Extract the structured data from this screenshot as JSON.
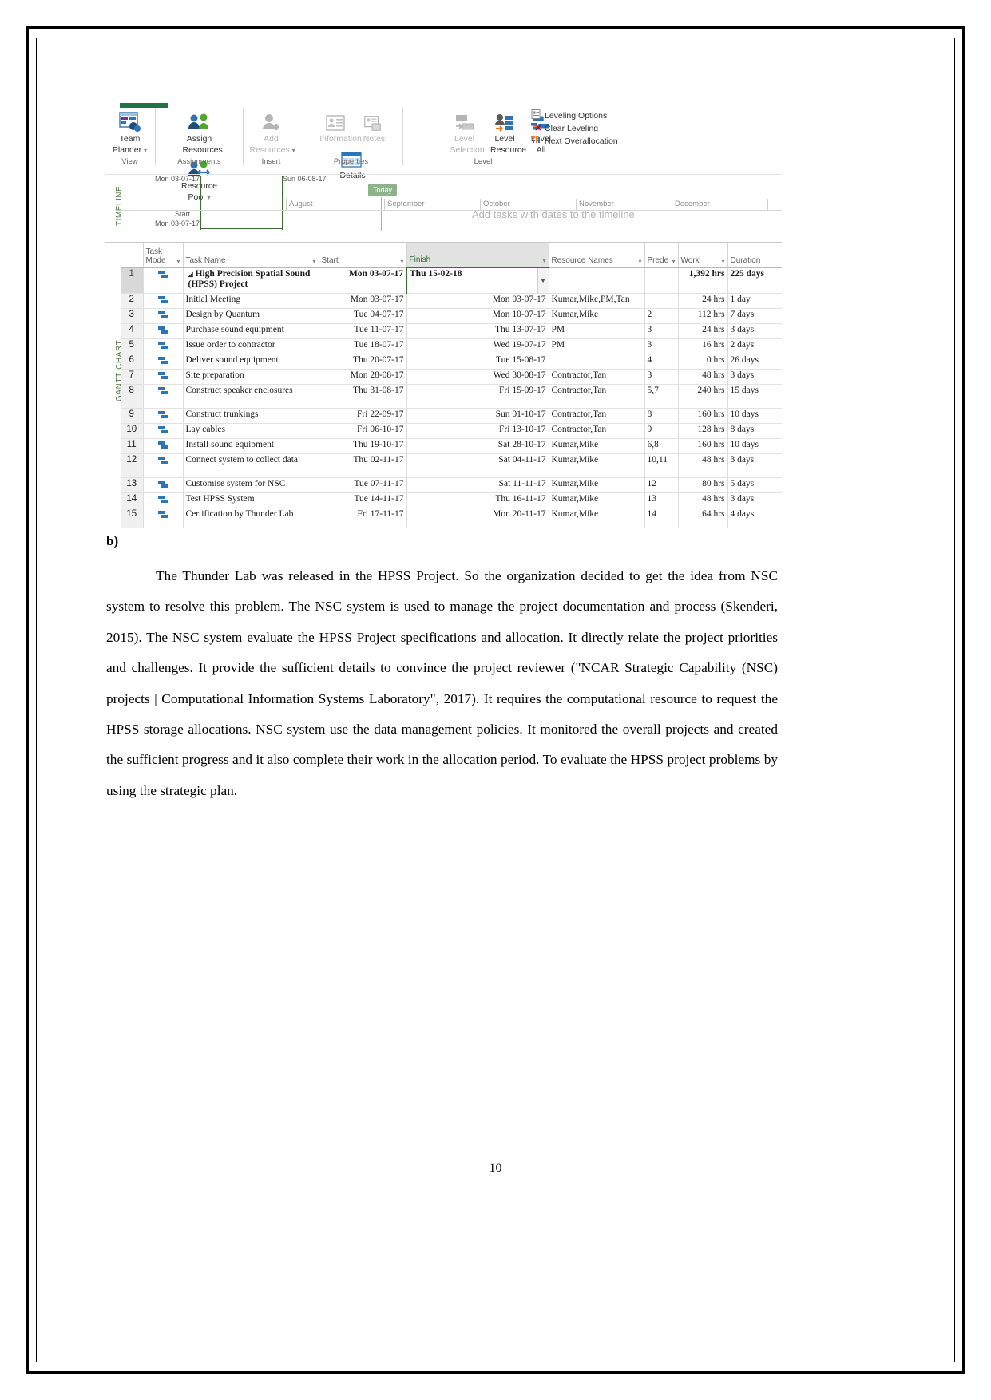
{
  "document": {
    "section_label": "b)",
    "paragraph": "The Thunder Lab was released in the HPSS Project. So the organization decided to get the idea from NSC system to resolve this problem. The NSC system is used to manage the project documentation and process (Skenderi, 2015). The NSC system evaluate the HPSS Project specifications and allocation. It directly relate the project priorities and challenges. It provide the sufficient details to convince the project reviewer (\"NCAR Strategic Capability (NSC) projects | Computational Information Systems Laboratory\", 2017).   It requires the computational resource to request the HPSS storage allocations. NSC system use the data management policies. It monitored the overall projects and created the sufficient progress and it also complete their work in the allocation period. To evaluate the HPSS project problems by using the strategic plan.",
    "page_number": "10"
  },
  "ribbon": {
    "accent_color": "#217346",
    "groups": [
      {
        "name": "View",
        "buttons": [
          {
            "label_line1": "Team",
            "label_line2": "Planner",
            "icon": "team-planner-icon",
            "has_caret": true,
            "dim": false
          }
        ]
      },
      {
        "name": "Assignments",
        "buttons": [
          {
            "label_line1": "Assign",
            "label_line2": "Resources",
            "icon": "assign-resources-icon",
            "has_caret": false,
            "dim": false
          },
          {
            "label_line1": "Resource",
            "label_line2": "Pool",
            "icon": "resource-pool-icon",
            "has_caret": true,
            "dim": false
          }
        ]
      },
      {
        "name": "Insert",
        "buttons": [
          {
            "label_line1": "Add",
            "label_line2": "Resources",
            "icon": "add-resources-icon",
            "has_caret": true,
            "dim": true
          }
        ]
      },
      {
        "name": "Properties",
        "buttons": [
          {
            "label_line1": "Information",
            "label_line2": "",
            "icon": "information-icon",
            "has_caret": false,
            "dim": true
          },
          {
            "label_line1": "Notes",
            "label_line2": "",
            "icon": "notes-icon",
            "has_caret": false,
            "dim": true
          },
          {
            "label_line1": "Details",
            "label_line2": "",
            "icon": "details-icon",
            "has_caret": false,
            "dim": false
          }
        ]
      },
      {
        "name": "Level",
        "buttons": [
          {
            "label_line1": "Level",
            "label_line2": "Selection",
            "icon": "level-selection-icon",
            "has_caret": false,
            "dim": true
          },
          {
            "label_line1": "Level",
            "label_line2": "Resource",
            "icon": "level-resource-icon",
            "has_caret": false,
            "dim": false
          },
          {
            "label_line1": "Level",
            "label_line2": "All",
            "icon": "level-all-icon",
            "has_caret": false,
            "dim": false
          }
        ],
        "small_buttons": [
          {
            "label": "Leveling Options",
            "icon": "leveling-options-icon"
          },
          {
            "label": "Clear Leveling",
            "icon": "clear-leveling-icon"
          },
          {
            "label": "Next Overallocation",
            "icon": "next-overallocation-icon"
          }
        ]
      }
    ]
  },
  "timeline": {
    "side_label": "TIMELINE",
    "top_left_date": "Mon 03-07-17",
    "top_mid_date": "Sun 06-08-17",
    "today_label": "Today",
    "start_label": "Start",
    "start_date": "Mon 03-07-17",
    "placeholder": "Add tasks with dates to the timeline",
    "months": [
      "August",
      "September",
      "October",
      "November",
      "December"
    ]
  },
  "gantt": {
    "side_label": "GANTT CHART",
    "columns": [
      {
        "key": "mode",
        "label_line1": "Task",
        "label_line2": "Mode",
        "caret": true,
        "selected": false
      },
      {
        "key": "name",
        "label_line1": "Task Name",
        "label_line2": "",
        "caret": true,
        "selected": false
      },
      {
        "key": "start",
        "label_line1": "Start",
        "label_line2": "",
        "caret": true,
        "selected": false
      },
      {
        "key": "finish",
        "label_line1": "Finish",
        "label_line2": "",
        "caret": true,
        "selected": true
      },
      {
        "key": "resources",
        "label_line1": "Resource Names",
        "label_line2": "",
        "caret": true,
        "selected": false
      },
      {
        "key": "pred",
        "label_line1": "Prede",
        "label_line2": "",
        "caret": true,
        "selected": false
      },
      {
        "key": "work",
        "label_line1": "Work",
        "label_line2": "",
        "caret": true,
        "selected": false
      },
      {
        "key": "duration",
        "label_line1": "Duration",
        "label_line2": "",
        "caret": false,
        "selected": false
      }
    ],
    "rows": [
      {
        "id": "1",
        "summary": true,
        "name": "High Precision Spatial Sound (HPSS) Project",
        "start": "Mon 03-07-17",
        "finish": "Thu 15-02-18",
        "resources": "",
        "pred": "",
        "work": "1,392 hrs",
        "duration": "225 days"
      },
      {
        "id": "2",
        "summary": false,
        "name": "Initial Meeting",
        "start": "Mon 03-07-17",
        "finish": "Mon 03-07-17",
        "resources": "Kumar,Mike,PM,Tan",
        "pred": "",
        "work": "24 hrs",
        "duration": "1 day"
      },
      {
        "id": "3",
        "summary": false,
        "name": "Design by Quantum",
        "start": "Tue 04-07-17",
        "finish": "Mon 10-07-17",
        "resources": "Kumar,Mike",
        "pred": "2",
        "work": "112 hrs",
        "duration": "7 days"
      },
      {
        "id": "4",
        "summary": false,
        "name": "Purchase sound equipment",
        "start": "Tue 11-07-17",
        "finish": "Thu 13-07-17",
        "resources": "PM",
        "pred": "3",
        "work": "24 hrs",
        "duration": "3 days"
      },
      {
        "id": "5",
        "summary": false,
        "name": "Issue order to contractor",
        "start": "Tue 18-07-17",
        "finish": "Wed 19-07-17",
        "resources": "PM",
        "pred": "3",
        "work": "16 hrs",
        "duration": "2 days"
      },
      {
        "id": "6",
        "summary": false,
        "name": "Deliver sound equipment",
        "start": "Thu 20-07-17",
        "finish": "Tue 15-08-17",
        "resources": "",
        "pred": "4",
        "work": "0 hrs",
        "duration": "26 days"
      },
      {
        "id": "7",
        "summary": false,
        "name": "Site preparation",
        "start": "Mon 28-08-17",
        "finish": "Wed 30-08-17",
        "resources": "Contractor,Tan",
        "pred": "3",
        "work": "48 hrs",
        "duration": "3 days"
      },
      {
        "id": "8",
        "summary": false,
        "name": "Construct speaker enclosures",
        "start": "Thu 31-08-17",
        "finish": "Fri 15-09-17",
        "resources": "Contractor,Tan",
        "pred": "5,7",
        "work": "240 hrs",
        "duration": "15 days",
        "tall": true
      },
      {
        "id": "9",
        "summary": false,
        "name": "Construct trunkings",
        "start": "Fri 22-09-17",
        "finish": "Sun 01-10-17",
        "resources": "Contractor,Tan",
        "pred": "8",
        "work": "160 hrs",
        "duration": "10 days"
      },
      {
        "id": "10",
        "summary": false,
        "name": "Lay cables",
        "start": "Fri 06-10-17",
        "finish": "Fri 13-10-17",
        "resources": "Contractor,Tan",
        "pred": "9",
        "work": "128 hrs",
        "duration": "8 days"
      },
      {
        "id": "11",
        "summary": false,
        "name": "Install sound equipment",
        "start": "Thu 19-10-17",
        "finish": "Sat 28-10-17",
        "resources": "Kumar,Mike",
        "pred": "6,8",
        "work": "160 hrs",
        "duration": "10 days"
      },
      {
        "id": "12",
        "summary": false,
        "name": "Connect system to collect data",
        "start": "Thu 02-11-17",
        "finish": "Sat 04-11-17",
        "resources": "Kumar,Mike",
        "pred": "10,11",
        "work": "48 hrs",
        "duration": "3 days",
        "tall": true
      },
      {
        "id": "13",
        "summary": false,
        "name": "Customise system for NSC",
        "start": "Tue 07-11-17",
        "finish": "Sat 11-11-17",
        "resources": "Kumar,Mike",
        "pred": "12",
        "work": "80 hrs",
        "duration": "5 days"
      },
      {
        "id": "14",
        "summary": false,
        "name": "Test HPSS System",
        "start": "Tue 14-11-17",
        "finish": "Thu 16-11-17",
        "resources": "Kumar,Mike",
        "pred": "13",
        "work": "48 hrs",
        "duration": "3 days"
      },
      {
        "id": "15",
        "summary": false,
        "name": "Certification by Thunder Lab",
        "start": "Fri 17-11-17",
        "finish": "Mon 20-11-17",
        "resources": "Kumar,Mike",
        "pred": "14",
        "work": "64 hrs",
        "duration": "4 days",
        "tall": true
      }
    ]
  }
}
